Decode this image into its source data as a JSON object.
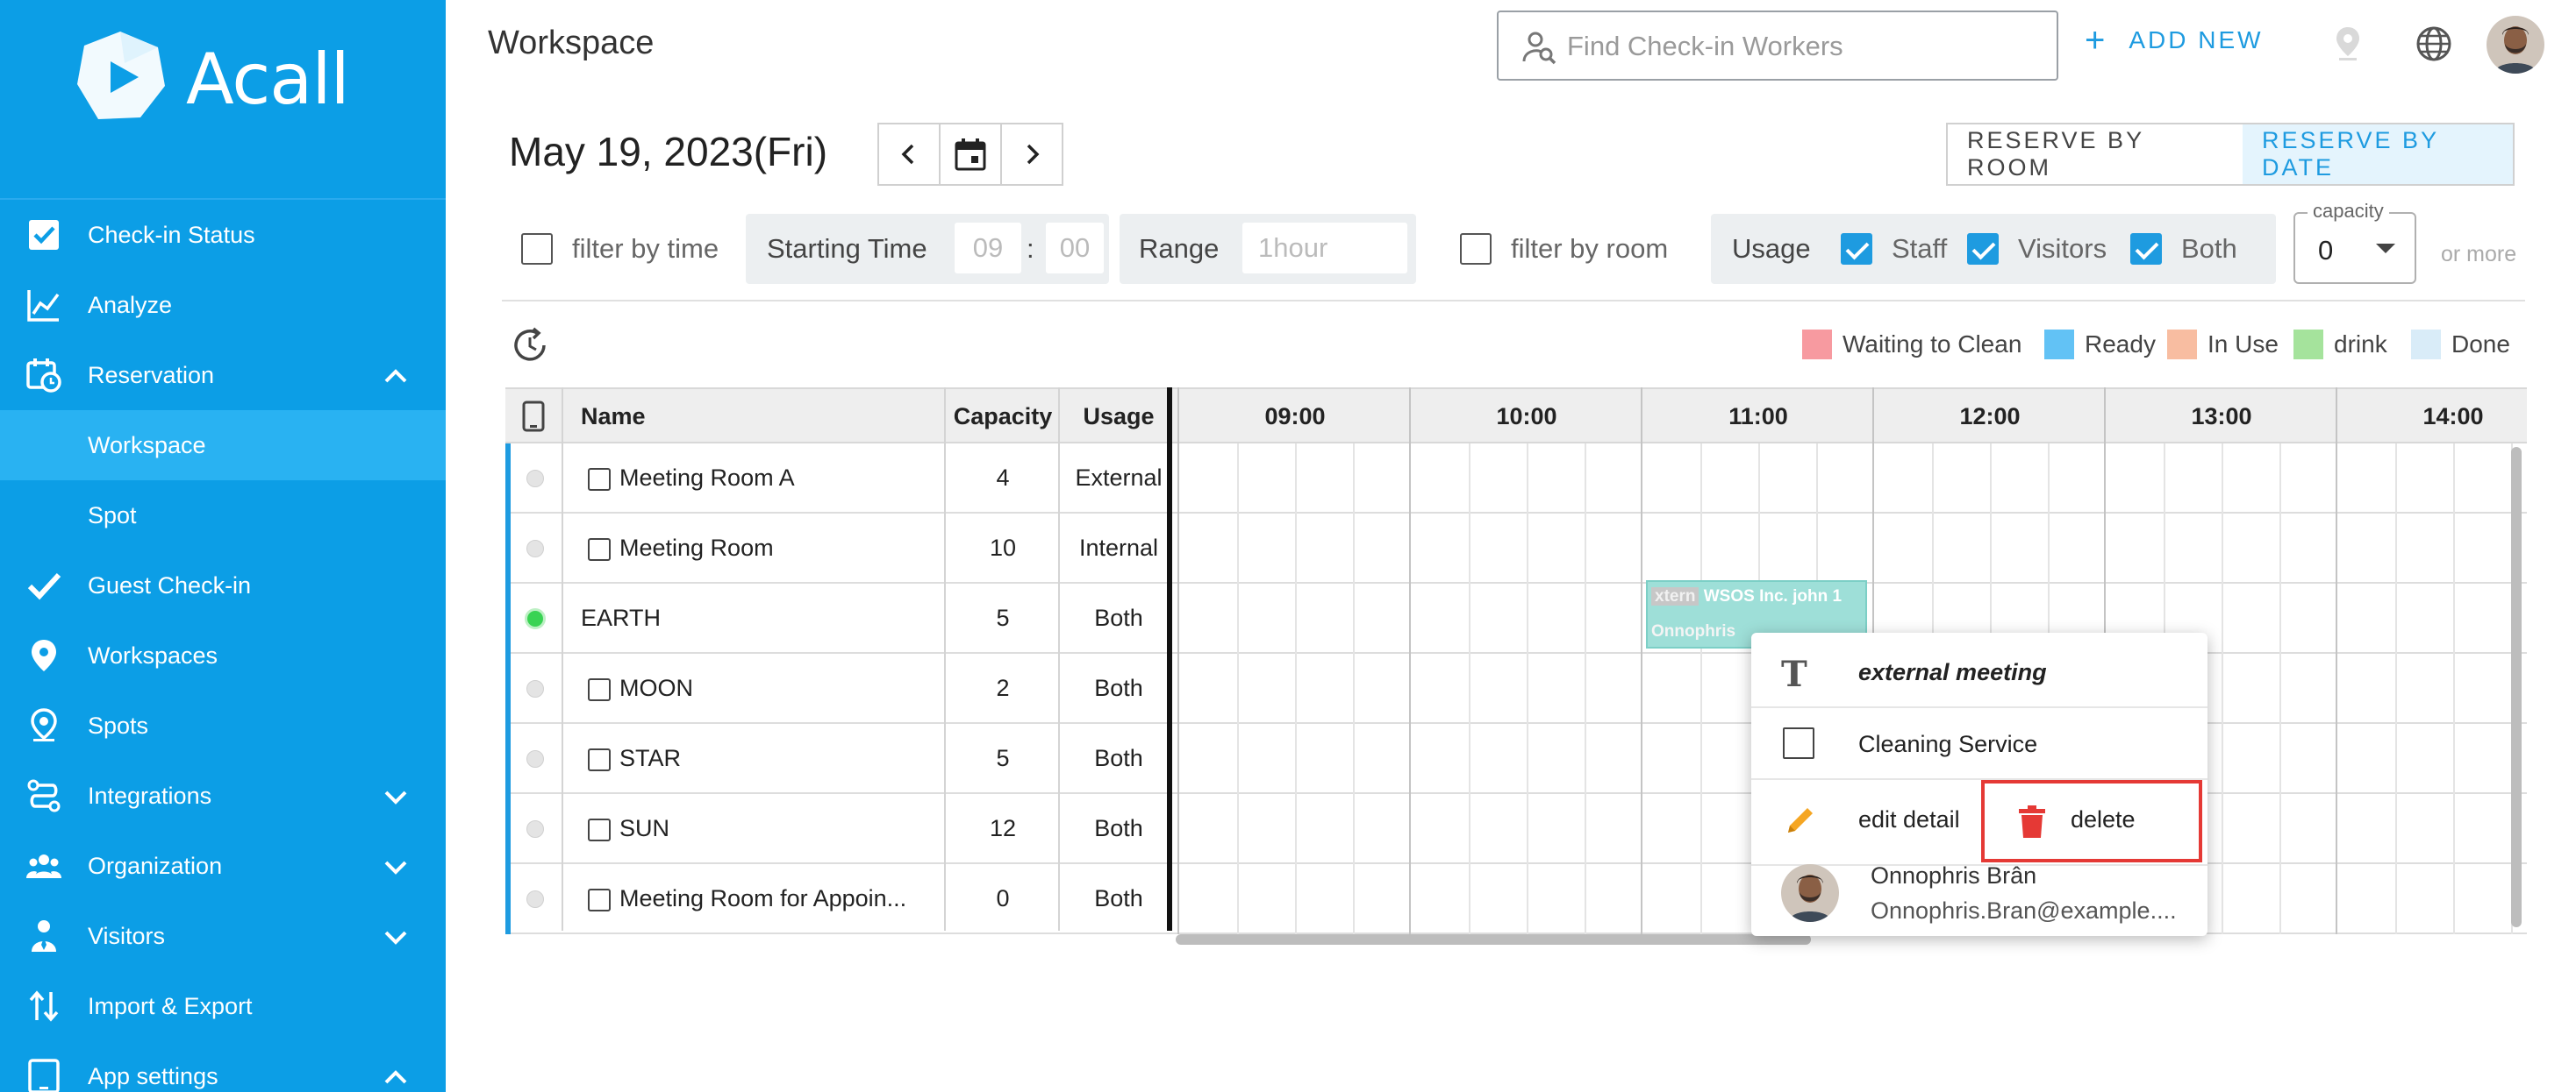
{
  "brand": {
    "name": "Acall",
    "accent": "#0c9ee6"
  },
  "sidebar": {
    "items": [
      {
        "label": "Check-in Status",
        "icon": "check-square-icon"
      },
      {
        "label": "Analyze",
        "icon": "line-chart-icon"
      },
      {
        "label": "Reservation",
        "icon": "calendar-clock-icon",
        "expanded": true
      },
      {
        "label": "Workspace",
        "sub": true,
        "active": true
      },
      {
        "label": "Spot",
        "sub": true
      },
      {
        "label": "Guest Check-in",
        "icon": "checkmark-icon"
      },
      {
        "label": "Workspaces",
        "icon": "map-pin-icon"
      },
      {
        "label": "Spots",
        "icon": "location-pin-icon"
      },
      {
        "label": "Integrations",
        "icon": "integrations-icon",
        "collapsible": true
      },
      {
        "label": "Organization",
        "icon": "people-icon",
        "collapsible": true
      },
      {
        "label": "Visitors",
        "icon": "visitor-icon",
        "collapsible": true
      },
      {
        "label": "Import & Export",
        "icon": "import-export-icon"
      },
      {
        "label": "App settings",
        "icon": "tablet-icon",
        "expanded": true
      }
    ]
  },
  "header": {
    "title": "Workspace",
    "search_placeholder": "Find Check-in Workers",
    "add_new": "ADD NEW",
    "add_plus": "+"
  },
  "datebar": {
    "date": "May 19, 2023(Fri)",
    "reserve_by_room": "RESERVE BY ROOM",
    "reserve_by_date": "RESERVE BY DATE"
  },
  "filters": {
    "filter_by_time": "filter by time",
    "starting_time": "Starting Time",
    "hour": "09",
    "colon": ":",
    "minute": "00",
    "range": "Range",
    "range_value": "1hour",
    "filter_by_room": "filter by room",
    "usage": "Usage",
    "staff": "Staff",
    "visitors": "Visitors",
    "both": "Both",
    "capacity_label": "capacity",
    "capacity_value": "0",
    "or_more": "or more"
  },
  "legend": [
    {
      "label": "Waiting to Clean",
      "color": "#f79aa0"
    },
    {
      "label": "Ready",
      "color": "#62c2f5"
    },
    {
      "label": "In Use",
      "color": "#f8bda1"
    },
    {
      "label": "drink",
      "color": "#a5e39c"
    },
    {
      "label": "Done",
      "color": "#d9ecf8"
    }
  ],
  "table": {
    "headers": {
      "name": "Name",
      "capacity": "Capacity",
      "usage": "Usage"
    },
    "hours": [
      "09:00",
      "10:00",
      "11:00",
      "12:00",
      "13:00",
      "14:00"
    ],
    "rows": [
      {
        "name": "Meeting Room A",
        "capacity": "4",
        "usage": "External",
        "checkbox": true,
        "status": "grey"
      },
      {
        "name": "Meeting Room",
        "capacity": "10",
        "usage": "Internal",
        "checkbox": true,
        "status": "grey"
      },
      {
        "name": "EARTH",
        "capacity": "5",
        "usage": "Both",
        "checkbox": false,
        "status": "green"
      },
      {
        "name": "MOON",
        "capacity": "2",
        "usage": "Both",
        "checkbox": true,
        "status": "grey"
      },
      {
        "name": "STAR",
        "capacity": "5",
        "usage": "Both",
        "checkbox": true,
        "status": "grey"
      },
      {
        "name": "SUN",
        "capacity": "12",
        "usage": "Both",
        "checkbox": true,
        "status": "grey"
      },
      {
        "name": "Meeting Room for Appoin...",
        "capacity": "0",
        "usage": "Both",
        "checkbox": true,
        "status": "grey"
      }
    ],
    "booking": {
      "tag": "xtern",
      "text1": "WSOS Inc. john 1",
      "text2": "Onnophris"
    }
  },
  "context_menu": {
    "title_icon": "T",
    "title": "external meeting",
    "cleaning": "Cleaning Service",
    "edit": "edit detail",
    "delete": "delete",
    "user_name": "Onnophris Brân",
    "user_email": "Onnophris.Bran@example...."
  }
}
